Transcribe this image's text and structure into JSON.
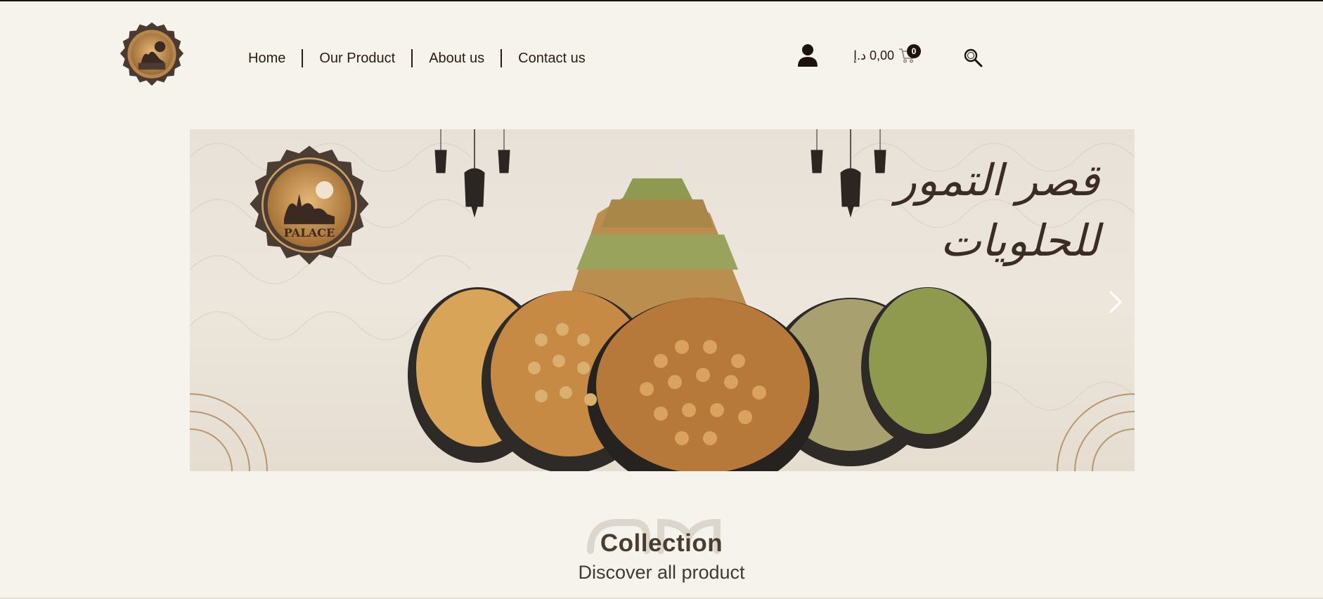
{
  "header": {
    "logo_text": "PALACE",
    "nav": [
      {
        "label": "Home"
      },
      {
        "label": "Our Product"
      },
      {
        "label": "About us"
      },
      {
        "label": "Contact us"
      }
    ],
    "cart": {
      "amount": "0,00 د.إ",
      "count": "0"
    },
    "icons": {
      "account": "user-icon",
      "cart": "cart-icon",
      "search": "search-icon"
    }
  },
  "hero": {
    "arabic_line1": "قصر التمور",
    "arabic_line2": "للحلويات",
    "logo_text": "PALACE"
  },
  "collection": {
    "title": "Collection",
    "subtitle": "Discover all product"
  },
  "colors": {
    "background": "#f6f3ec",
    "text": "#2b1a12",
    "gold": "#c99a5b",
    "dark": "#1d120d"
  }
}
